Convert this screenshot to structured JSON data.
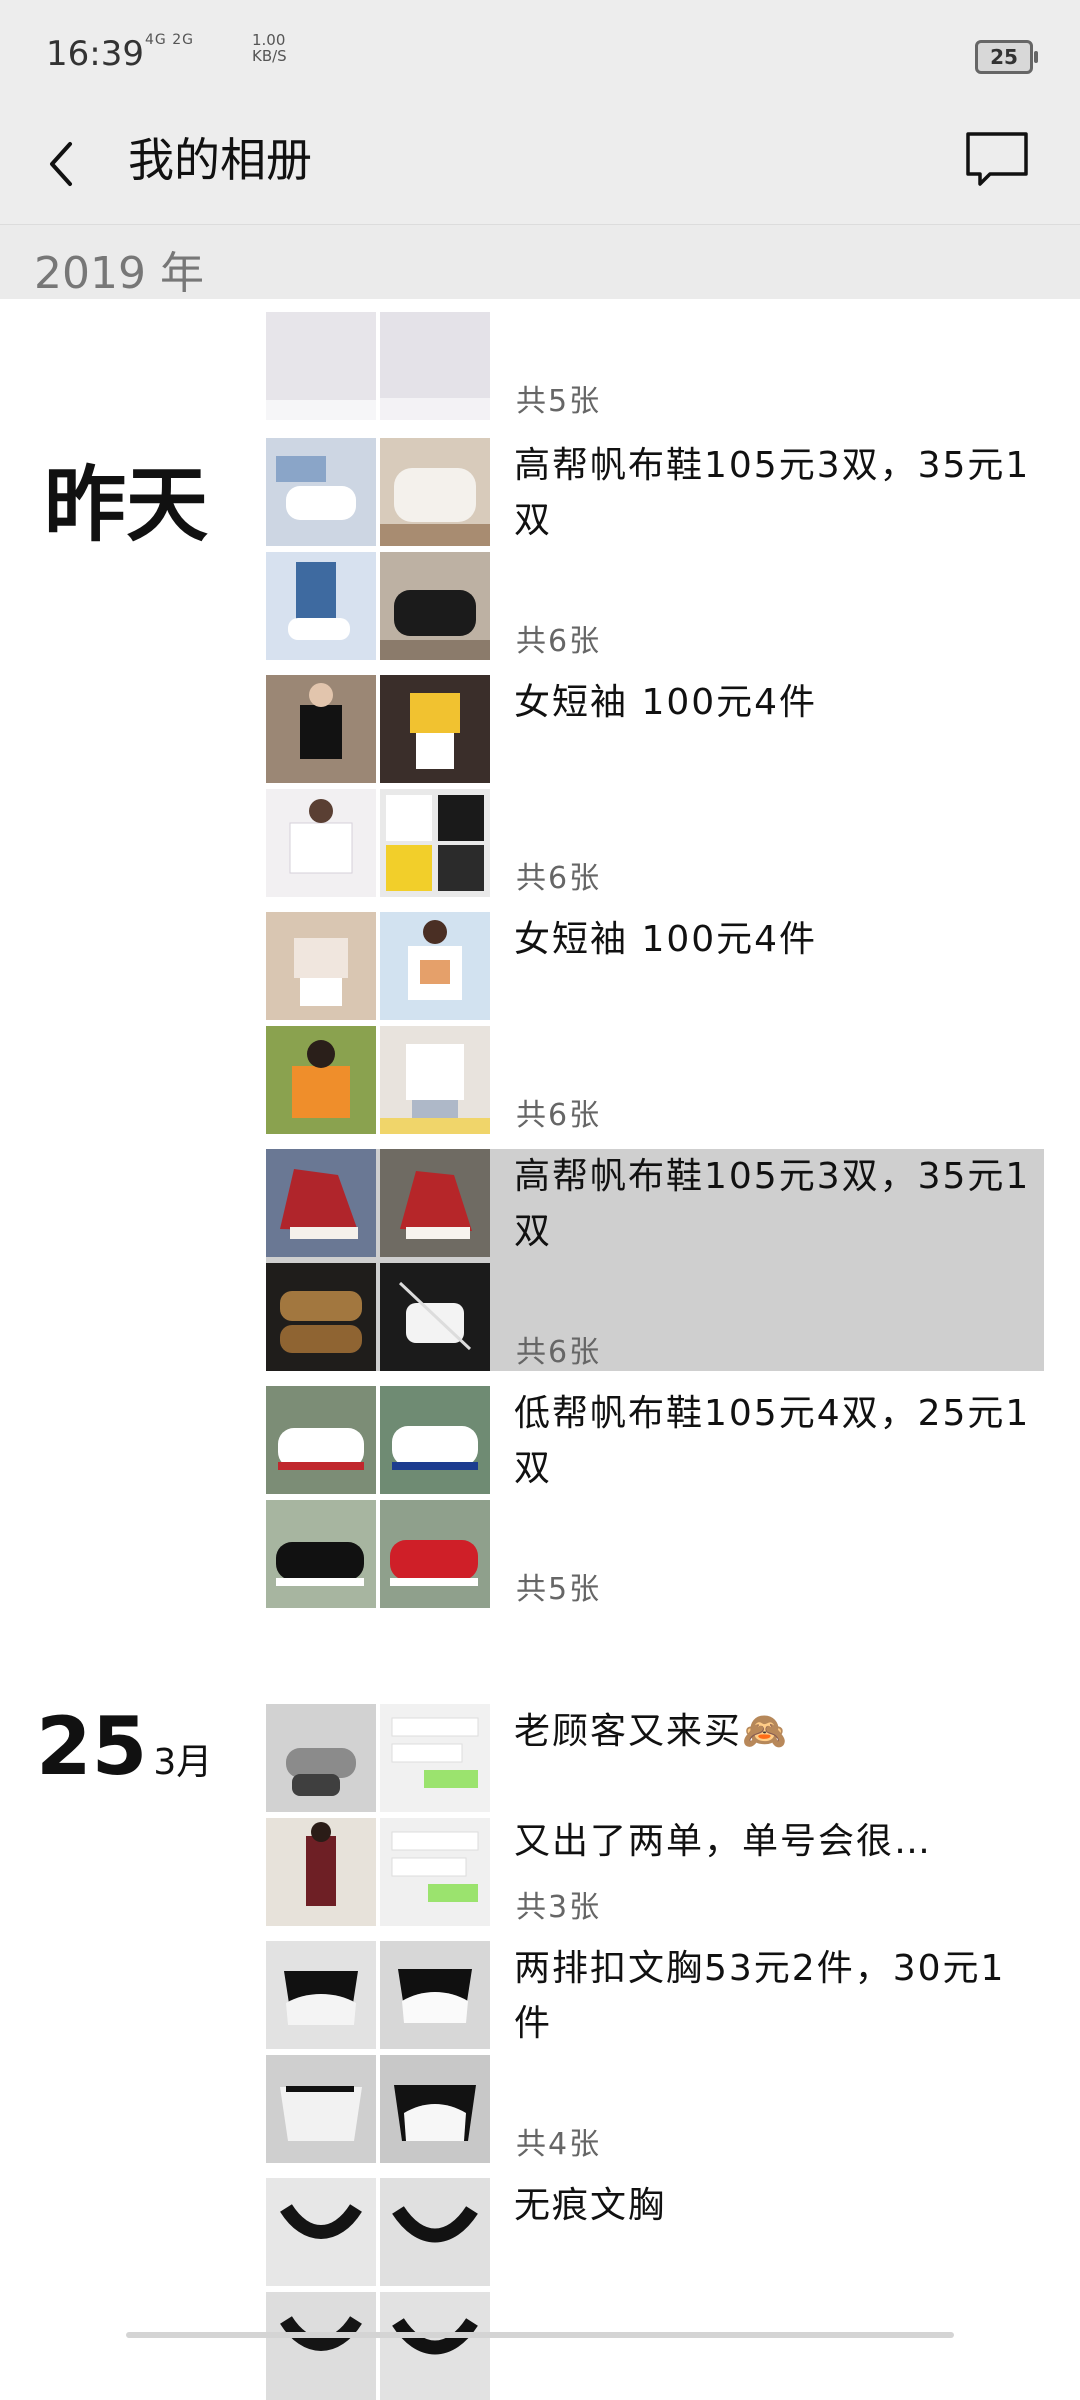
{
  "status": {
    "time": "16:39",
    "signal": "4G 2G",
    "speed_value": "1.00",
    "speed_unit": "KB/S",
    "battery": "25"
  },
  "header": {
    "title": "我的相册",
    "back_icon": "back-icon",
    "comment_icon": "comment-icon"
  },
  "year_label": "2019 年",
  "groups": [
    {
      "day": "",
      "month": ""
    },
    {
      "day": "昨天",
      "month": ""
    },
    {
      "day": "25",
      "month": "3月"
    }
  ],
  "entries": [
    {
      "text": "",
      "count": "共5张",
      "selected": false
    },
    {
      "text": "高帮帆布鞋105元3双，35元1双",
      "count": "共6张",
      "selected": false
    },
    {
      "text": "女短袖 100元4件",
      "count": "共6张",
      "selected": false
    },
    {
      "text": "女短袖 100元4件",
      "count": "共6张",
      "selected": false
    },
    {
      "text": "高帮帆布鞋105元3双，35元1双",
      "count": "共6张",
      "selected": true
    },
    {
      "text": "低帮帆布鞋105元4双，25元1双",
      "count": "共5张",
      "selected": false
    },
    {
      "text": "老顾客又来买🙈\n\n又出了两单，单号会很…",
      "count": "共3张",
      "selected": false
    },
    {
      "text": "两排扣文胸53元2件，30元1件",
      "count": "共4张",
      "selected": false
    },
    {
      "text": "无痕文胸",
      "count": "",
      "selected": false
    }
  ]
}
